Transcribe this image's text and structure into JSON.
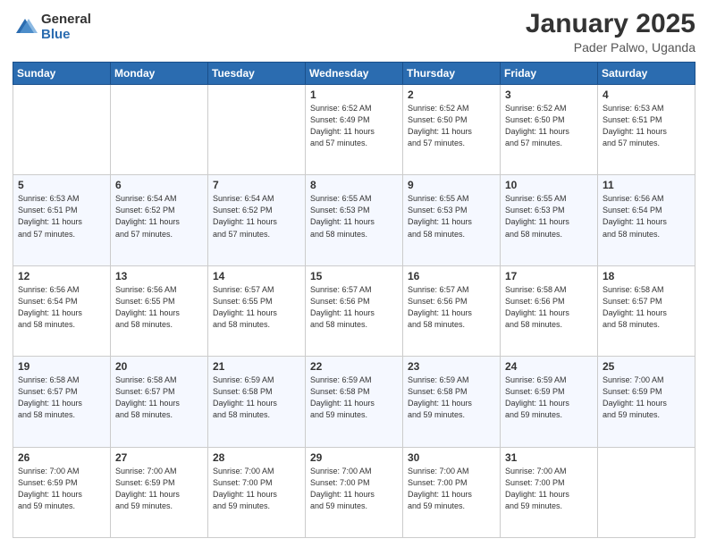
{
  "header": {
    "logo_general": "General",
    "logo_blue": "Blue",
    "title": "January 2025",
    "subtitle": "Pader Palwo, Uganda"
  },
  "days_of_week": [
    "Sunday",
    "Monday",
    "Tuesday",
    "Wednesday",
    "Thursday",
    "Friday",
    "Saturday"
  ],
  "weeks": [
    [
      {
        "day": "",
        "info": ""
      },
      {
        "day": "",
        "info": ""
      },
      {
        "day": "",
        "info": ""
      },
      {
        "day": "1",
        "info": "Sunrise: 6:52 AM\nSunset: 6:49 PM\nDaylight: 11 hours\nand 57 minutes."
      },
      {
        "day": "2",
        "info": "Sunrise: 6:52 AM\nSunset: 6:50 PM\nDaylight: 11 hours\nand 57 minutes."
      },
      {
        "day": "3",
        "info": "Sunrise: 6:52 AM\nSunset: 6:50 PM\nDaylight: 11 hours\nand 57 minutes."
      },
      {
        "day": "4",
        "info": "Sunrise: 6:53 AM\nSunset: 6:51 PM\nDaylight: 11 hours\nand 57 minutes."
      }
    ],
    [
      {
        "day": "5",
        "info": "Sunrise: 6:53 AM\nSunset: 6:51 PM\nDaylight: 11 hours\nand 57 minutes."
      },
      {
        "day": "6",
        "info": "Sunrise: 6:54 AM\nSunset: 6:52 PM\nDaylight: 11 hours\nand 57 minutes."
      },
      {
        "day": "7",
        "info": "Sunrise: 6:54 AM\nSunset: 6:52 PM\nDaylight: 11 hours\nand 57 minutes."
      },
      {
        "day": "8",
        "info": "Sunrise: 6:55 AM\nSunset: 6:53 PM\nDaylight: 11 hours\nand 58 minutes."
      },
      {
        "day": "9",
        "info": "Sunrise: 6:55 AM\nSunset: 6:53 PM\nDaylight: 11 hours\nand 58 minutes."
      },
      {
        "day": "10",
        "info": "Sunrise: 6:55 AM\nSunset: 6:53 PM\nDaylight: 11 hours\nand 58 minutes."
      },
      {
        "day": "11",
        "info": "Sunrise: 6:56 AM\nSunset: 6:54 PM\nDaylight: 11 hours\nand 58 minutes."
      }
    ],
    [
      {
        "day": "12",
        "info": "Sunrise: 6:56 AM\nSunset: 6:54 PM\nDaylight: 11 hours\nand 58 minutes."
      },
      {
        "day": "13",
        "info": "Sunrise: 6:56 AM\nSunset: 6:55 PM\nDaylight: 11 hours\nand 58 minutes."
      },
      {
        "day": "14",
        "info": "Sunrise: 6:57 AM\nSunset: 6:55 PM\nDaylight: 11 hours\nand 58 minutes."
      },
      {
        "day": "15",
        "info": "Sunrise: 6:57 AM\nSunset: 6:56 PM\nDaylight: 11 hours\nand 58 minutes."
      },
      {
        "day": "16",
        "info": "Sunrise: 6:57 AM\nSunset: 6:56 PM\nDaylight: 11 hours\nand 58 minutes."
      },
      {
        "day": "17",
        "info": "Sunrise: 6:58 AM\nSunset: 6:56 PM\nDaylight: 11 hours\nand 58 minutes."
      },
      {
        "day": "18",
        "info": "Sunrise: 6:58 AM\nSunset: 6:57 PM\nDaylight: 11 hours\nand 58 minutes."
      }
    ],
    [
      {
        "day": "19",
        "info": "Sunrise: 6:58 AM\nSunset: 6:57 PM\nDaylight: 11 hours\nand 58 minutes."
      },
      {
        "day": "20",
        "info": "Sunrise: 6:58 AM\nSunset: 6:57 PM\nDaylight: 11 hours\nand 58 minutes."
      },
      {
        "day": "21",
        "info": "Sunrise: 6:59 AM\nSunset: 6:58 PM\nDaylight: 11 hours\nand 58 minutes."
      },
      {
        "day": "22",
        "info": "Sunrise: 6:59 AM\nSunset: 6:58 PM\nDaylight: 11 hours\nand 59 minutes."
      },
      {
        "day": "23",
        "info": "Sunrise: 6:59 AM\nSunset: 6:58 PM\nDaylight: 11 hours\nand 59 minutes."
      },
      {
        "day": "24",
        "info": "Sunrise: 6:59 AM\nSunset: 6:59 PM\nDaylight: 11 hours\nand 59 minutes."
      },
      {
        "day": "25",
        "info": "Sunrise: 7:00 AM\nSunset: 6:59 PM\nDaylight: 11 hours\nand 59 minutes."
      }
    ],
    [
      {
        "day": "26",
        "info": "Sunrise: 7:00 AM\nSunset: 6:59 PM\nDaylight: 11 hours\nand 59 minutes."
      },
      {
        "day": "27",
        "info": "Sunrise: 7:00 AM\nSunset: 6:59 PM\nDaylight: 11 hours\nand 59 minutes."
      },
      {
        "day": "28",
        "info": "Sunrise: 7:00 AM\nSunset: 7:00 PM\nDaylight: 11 hours\nand 59 minutes."
      },
      {
        "day": "29",
        "info": "Sunrise: 7:00 AM\nSunset: 7:00 PM\nDaylight: 11 hours\nand 59 minutes."
      },
      {
        "day": "30",
        "info": "Sunrise: 7:00 AM\nSunset: 7:00 PM\nDaylight: 11 hours\nand 59 minutes."
      },
      {
        "day": "31",
        "info": "Sunrise: 7:00 AM\nSunset: 7:00 PM\nDaylight: 11 hours\nand 59 minutes."
      },
      {
        "day": "",
        "info": ""
      }
    ]
  ]
}
